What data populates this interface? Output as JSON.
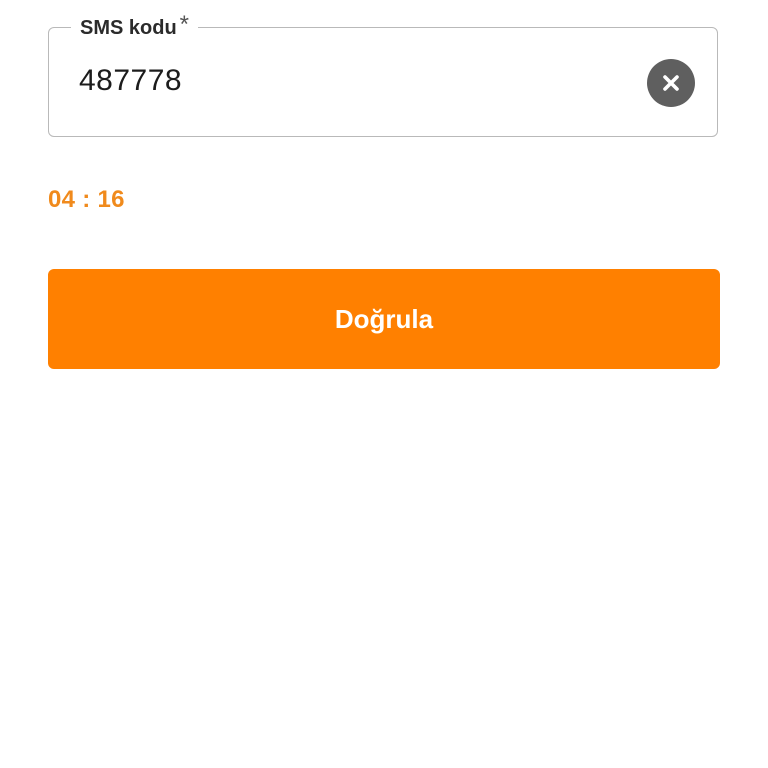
{
  "sms_field": {
    "label": "SMS kodu",
    "required_mark": "*",
    "value": "487778",
    "clear_icon": "close-icon"
  },
  "timer": {
    "text": "04 : 16"
  },
  "verify_button": {
    "label": "Doğrula"
  },
  "colors": {
    "accent": "#ff8000",
    "timer": "#f08a1c",
    "clear_button": "#5f5f5f",
    "border": "#b9b9b9"
  }
}
